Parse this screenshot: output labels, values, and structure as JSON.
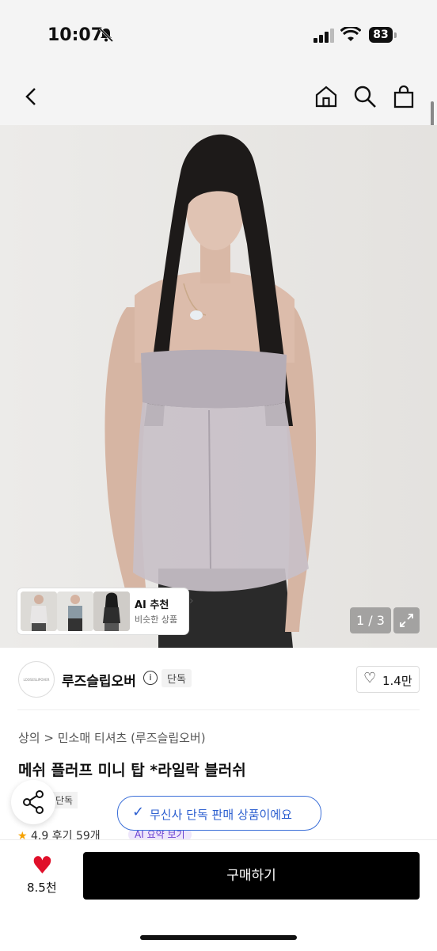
{
  "status": {
    "time": "10:07",
    "battery": "83"
  },
  "gallery": {
    "counter": "1 / 3",
    "ai_card": {
      "title": "AI 추천",
      "subtitle": "비슷한 상품"
    }
  },
  "brand": {
    "name": "루즈슬립오버",
    "logo_text": "LOOSESLIPOVER",
    "exclusive": "단독",
    "likes": "1.4만"
  },
  "product": {
    "breadcrumb": [
      "상의",
      "민소매 티셔츠 (루즈슬립오버)"
    ],
    "title": "메쉬 플러프 미니 탑 *라일락 블러쉬",
    "tag": "단독",
    "rating": "4.9",
    "reviews": "후기 59개",
    "ai_summary": "AI 요약 보기"
  },
  "toast": "무신사 단독 판매 상품이에요",
  "bottom": {
    "likes": "8.5천",
    "buy_label": "구매하기"
  }
}
